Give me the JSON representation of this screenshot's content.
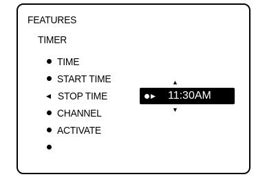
{
  "menu": {
    "heading": "FEATURES",
    "subheading": "TIMER",
    "items": [
      {
        "marker": "bullet",
        "label": "TIME"
      },
      {
        "marker": "bullet",
        "label": "START TIME"
      },
      {
        "marker": "pointer",
        "label": "STOP TIME"
      },
      {
        "marker": "bullet",
        "label": "CHANNEL"
      },
      {
        "marker": "bullet",
        "label": "ACTIVATE"
      },
      {
        "marker": "bullet",
        "label": ""
      }
    ]
  },
  "time_field": {
    "value": "11:30AM"
  },
  "icons": {
    "up": "up-arrow-icon",
    "down": "down-arrow-icon",
    "pointer": "left-pointer-icon",
    "bullet": "bullet-icon"
  },
  "colors": {
    "background": "#ffffff",
    "foreground": "#000000",
    "highlight_bg": "#000000",
    "highlight_fg": "#ffffff"
  }
}
